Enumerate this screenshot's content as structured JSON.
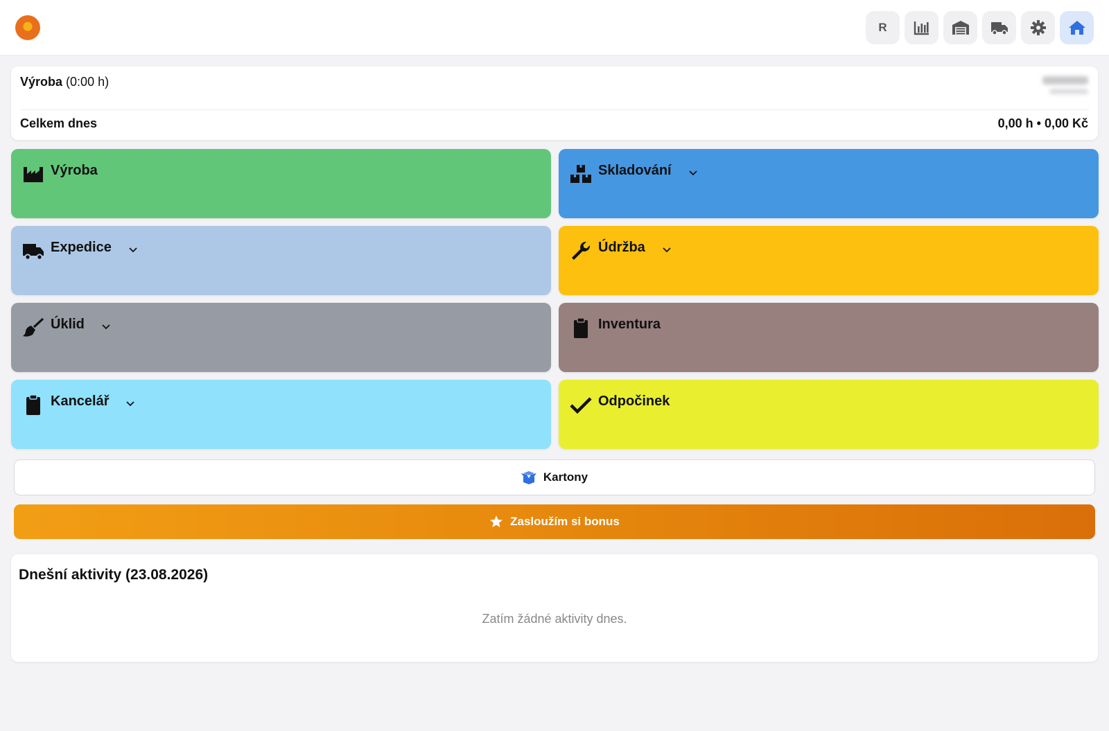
{
  "header": {
    "nav": [
      {
        "name": "nav-reports-r",
        "label": "R"
      },
      {
        "name": "nav-stats",
        "icon": "bar-chart-icon"
      },
      {
        "name": "nav-warehouse",
        "icon": "warehouse-icon"
      },
      {
        "name": "nav-shipping",
        "icon": "truck-icon"
      },
      {
        "name": "nav-settings",
        "icon": "gear-icon"
      },
      {
        "name": "nav-home",
        "icon": "home-icon",
        "active": true
      }
    ],
    "accent": "#2f6fe0"
  },
  "summary": {
    "activity_name": "Výroba",
    "activity_duration": "(0:00 h)",
    "total_label": "Celkem dnes",
    "total_value": "0,00 h • 0,00 Kč"
  },
  "tiles": [
    {
      "label": "Výroba",
      "icon": "factory-icon",
      "color": "#62c679",
      "dropdown": false
    },
    {
      "label": "Skladování",
      "icon": "boxes-icon",
      "color": "#4697e2",
      "dropdown": true
    },
    {
      "label": "Expedice",
      "icon": "truck-icon",
      "color": "#adc8e6",
      "dropdown": true
    },
    {
      "label": "Údržba",
      "icon": "wrench-icon",
      "color": "#fdc00e",
      "dropdown": true
    },
    {
      "label": "Úklid",
      "icon": "broom-icon",
      "color": "#979ba3",
      "dropdown": true
    },
    {
      "label": "Inventura",
      "icon": "clipboard-icon",
      "color": "#98807e",
      "dropdown": false
    },
    {
      "label": "Kancelář",
      "icon": "clipboard-icon",
      "color": "#90e1fc",
      "dropdown": true
    },
    {
      "label": "Odpočinek",
      "icon": "check-icon",
      "color": "#e9ef2f",
      "dropdown": false
    }
  ],
  "actions": {
    "cartons_label": "Kartony",
    "bonus_label": "Zasloužím si bonus"
  },
  "activities": {
    "title": "Dnešní aktivity (23.08.2026)",
    "empty_text": "Zatím žádné aktivity dnes."
  }
}
